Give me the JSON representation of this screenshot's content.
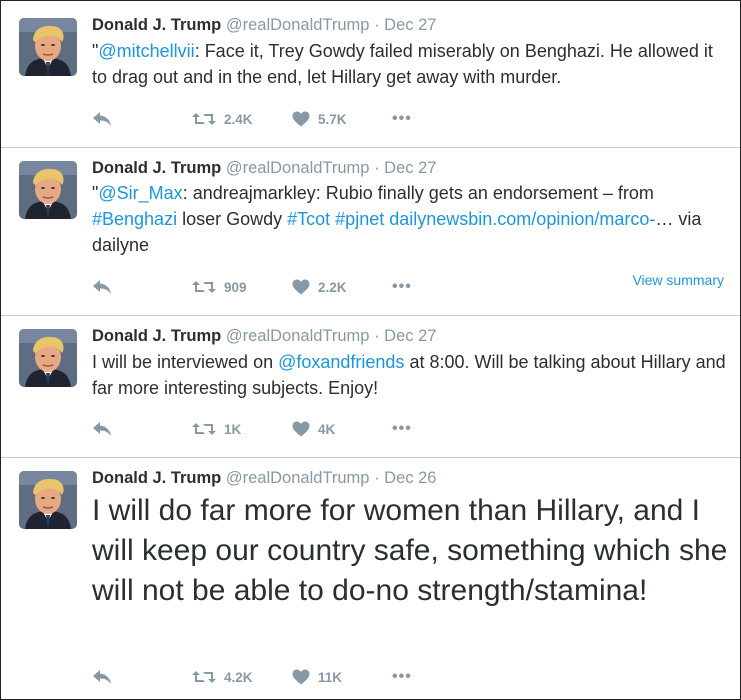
{
  "tweets": [
    {
      "name": "Donald J. Trump",
      "handle": "@realDonaldTrump",
      "sep": "·",
      "date": "Dec 27",
      "text_parts": [
        {
          "t": "\"",
          "link": false
        },
        {
          "t": "@mitchellvii",
          "link": true
        },
        {
          "t": ": Face it, Trey Gowdy failed miserably on Benghazi. He allowed it to drag out and in the end, let Hillary get away with murder.",
          "link": false
        }
      ],
      "retweets": "2.4K",
      "likes": "5.7K",
      "more": "•••"
    },
    {
      "name": "Donald J. Trump",
      "handle": "@realDonaldTrump",
      "sep": "·",
      "date": "Dec 27",
      "text_parts": [
        {
          "t": "\"",
          "link": false
        },
        {
          "t": "@Sir_Max",
          "link": true
        },
        {
          "t": ": andreajmarkley: Rubio finally gets an endorsement – from ",
          "link": false
        },
        {
          "t": "#Benghazi",
          "link": true
        },
        {
          "t": " loser Gowdy ",
          "link": false
        },
        {
          "t": "#Tcot",
          "link": true
        },
        {
          "t": " ",
          "link": false
        },
        {
          "t": "#pjnet",
          "link": true
        },
        {
          "t": " ",
          "link": false
        },
        {
          "t": "dailynewsbin.com/opinion/marco-",
          "link": true
        },
        {
          "t": "… via dailyne",
          "link": false
        }
      ],
      "summary_link": "View summary",
      "retweets": "909",
      "likes": "2.2K",
      "more": "•••"
    },
    {
      "name": "Donald J. Trump",
      "handle": "@realDonaldTrump",
      "sep": "·",
      "date": "Dec 27",
      "text_parts": [
        {
          "t": "I will be interviewed on ",
          "link": false
        },
        {
          "t": "@foxandfriends",
          "link": true
        },
        {
          "t": " at 8:00. Will be talking about Hillary and far more interesting subjects. Enjoy!",
          "link": false
        }
      ],
      "retweets": "1K",
      "likes": "4K",
      "more": "•••"
    },
    {
      "name": "Donald J. Trump",
      "handle": "@realDonaldTrump",
      "sep": "·",
      "date": "Dec 26",
      "text_parts": [
        {
          "t": "I will do far more for women than Hillary, and I will keep our country safe, something which she will not be able to do-no strength/stamina!",
          "link": false
        }
      ],
      "retweets": "4.2K",
      "likes": "11K",
      "more": "•••"
    }
  ]
}
